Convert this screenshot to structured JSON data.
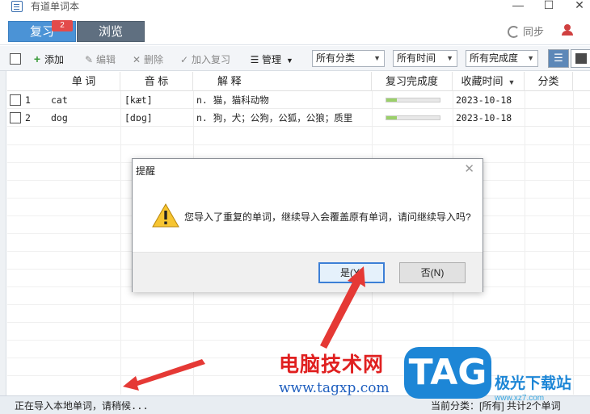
{
  "window": {
    "title": "有道单词本",
    "min_glyph": "—",
    "max_glyph": "☐",
    "close_glyph": "✕"
  },
  "modes": {
    "review_label": "复习",
    "review_badge": "2",
    "browse_label": "浏览",
    "sync_label": "同步"
  },
  "toolbar": {
    "add": "添加",
    "edit": "编辑",
    "delete": "删除",
    "add_review": "加入复习",
    "manage": "管理",
    "category_select": "所有分类",
    "time_select": "所有时间",
    "completion_select": "所有完成度"
  },
  "table": {
    "headers": {
      "word": "单 词",
      "phonetic": "音 标",
      "meaning": "解 释",
      "progress": "复习完成度",
      "time": "收藏时间",
      "category": "分类"
    },
    "rows": [
      {
        "index": "1",
        "word": "cat",
        "phonetic": "[kæt]",
        "meaning": "n. 猫，猫科动物",
        "progress": 0.2,
        "time": "2023-10-18"
      },
      {
        "index": "2",
        "word": "dog",
        "phonetic": "[dɒɡ]",
        "meaning": "n. 狗，犬；公狗，公狐，公狼；质里",
        "progress": 0.2,
        "time": "2023-10-18"
      }
    ]
  },
  "dialog": {
    "title": "提醒",
    "message": "您导入了重复的单词，继续导入会覆盖原有单词，请问继续导入吗?",
    "yes_label": "是(Y)",
    "no_label": "否(N)"
  },
  "status": {
    "left": "正在导入本地单词，请稍候...",
    "right": "当前分类：[所有]   共计2个单词"
  },
  "watermark": {
    "cn_text": "电脑技术网",
    "url": "www.tagxp.com",
    "logo": "TAG",
    "site": "极光下载站",
    "site_url": "www.xz7.com"
  },
  "colors": {
    "annotation_arrow": "#e53935",
    "review_tab": "#4b93d6",
    "browse_tab": "#5f6f80",
    "progress_fill": "#9bd06a"
  }
}
